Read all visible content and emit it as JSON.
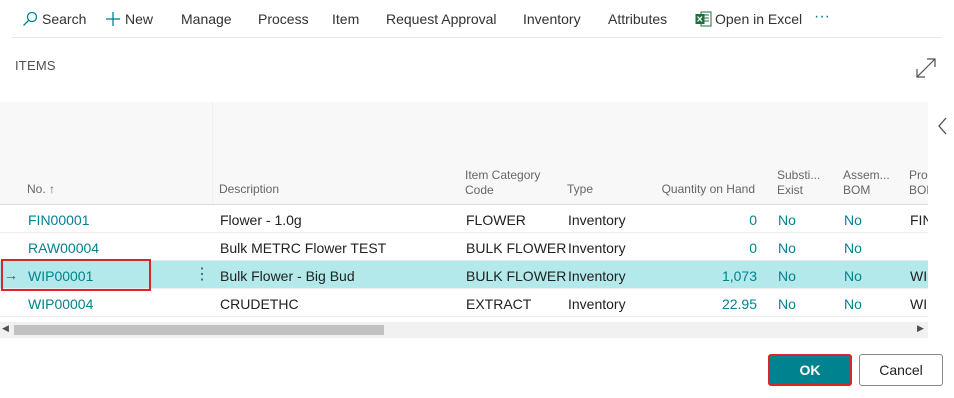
{
  "toolbar": {
    "search": "Search",
    "new": "New",
    "manage": "Manage",
    "process": "Process",
    "item": "Item",
    "request_approval": "Request Approval",
    "inventory": "Inventory",
    "attributes": "Attributes",
    "open_in_excel": "Open in Excel",
    "more": "···"
  },
  "page": {
    "title": "ITEMS"
  },
  "columns": {
    "no": "No. ↑",
    "description": "Description",
    "item_category_l1": "Item Category",
    "item_category_l2": "Code",
    "type": "Type",
    "qty_on_hand": "Quantity on Hand",
    "subst_l1": "Substi...",
    "subst_l2": "Exist",
    "assem_l1": "Assem...",
    "assem_l2": "BOM",
    "prod_l1": "Pro",
    "prod_l2": "BOM"
  },
  "rows": [
    {
      "no": "FIN00001",
      "description": "Flower - 1.0g",
      "category": "FLOWER",
      "type": "Inventory",
      "qty": "0",
      "subst": "No",
      "assem": "No",
      "prod": "FIN"
    },
    {
      "no": "RAW00004",
      "description": "Bulk METRC Flower TEST",
      "category": "BULK FLOWER",
      "type": "Inventory",
      "qty": "0",
      "subst": "No",
      "assem": "No",
      "prod": ""
    },
    {
      "no": "WIP00001",
      "description": "Bulk Flower - Big Bud",
      "category": "BULK FLOWER",
      "type": "Inventory",
      "qty": "1,073",
      "subst": "No",
      "assem": "No",
      "prod": "WI",
      "selected": true
    },
    {
      "no": "WIP00004",
      "description": "CRUDETHC",
      "category": "EXTRACT",
      "type": "Inventory",
      "qty": "22.95",
      "subst": "No",
      "assem": "No",
      "prod": "WI"
    }
  ],
  "row_marker": "→",
  "row_menu": "⋮",
  "buttons": {
    "ok": "OK",
    "cancel": "Cancel"
  },
  "colors": {
    "accent": "#00838f",
    "selected_row": "#b3e9ea",
    "highlight_box": "#d9262b",
    "excel_green": "#1d6f42"
  },
  "icons": {
    "search": "search-icon",
    "new": "plus-icon",
    "excel": "excel-icon",
    "expand": "expand-icon",
    "collapse": "chevron-left-icon"
  }
}
